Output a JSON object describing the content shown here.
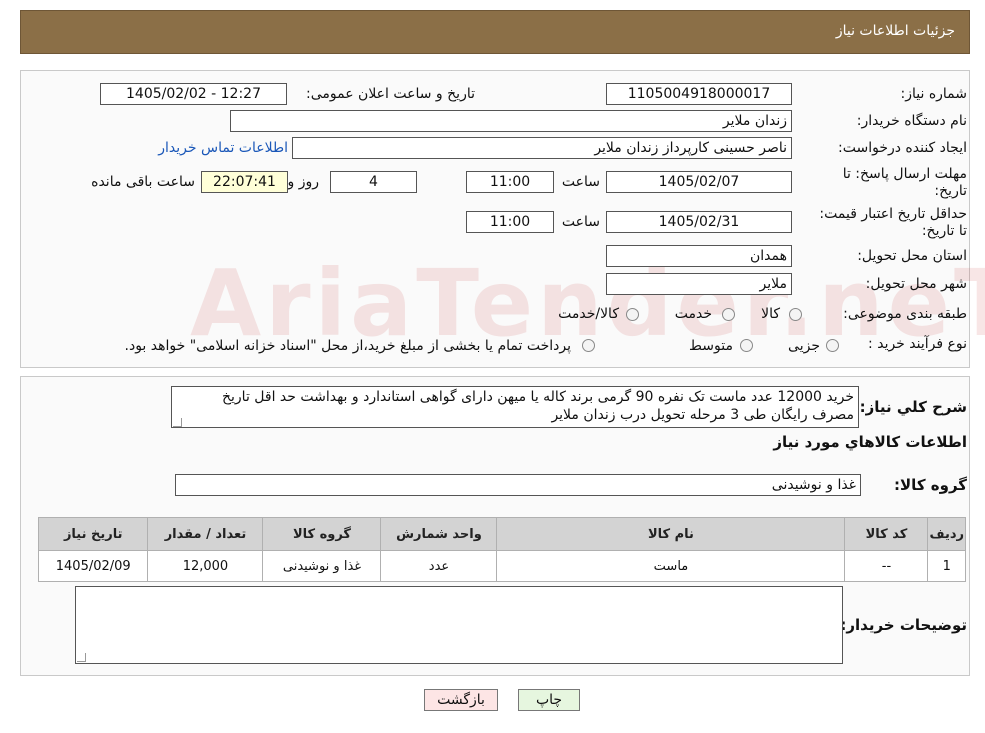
{
  "header": {
    "title": "جزئیات اطلاعات نیاز"
  },
  "watermark": "AriaTender.neT",
  "form": {
    "need_number": {
      "label": "شماره نیاز:",
      "value": "1105004918000017"
    },
    "announce_datetime": {
      "label": "تاریخ و ساعت اعلان عمومی:",
      "value": "1405/02/02 - 12:27"
    },
    "buyer_org": {
      "label": "نام دستگاه خریدار:",
      "value": "زندان ملایر"
    },
    "requester": {
      "label": "ایجاد کننده درخواست:",
      "value": "ناصر  حسینی کارپرداز زندان ملایر",
      "contact_link": "اطلاعات تماس خریدار"
    },
    "reply_deadline": {
      "label": "مهلت ارسال پاسخ: تا تاریخ:",
      "date": "1405/02/07",
      "time_label": "ساعت",
      "time": "11:00",
      "days": "4",
      "days_label": "روز و",
      "remaining": "22:07:41",
      "remaining_label": "ساعت باقی مانده"
    },
    "price_validity": {
      "label": "حداقل تاریخ اعتبار قیمت: تا تاریخ:",
      "date": "1405/02/31",
      "time_label": "ساعت",
      "time": "11:00"
    },
    "province": {
      "label": "استان محل تحویل:",
      "value": "همدان"
    },
    "city": {
      "label": "شهر محل تحویل:",
      "value": "ملایر"
    },
    "category": {
      "label": "طبقه بندی موضوعی:",
      "options": [
        "کالا",
        "خدمت",
        "کالا/خدمت"
      ]
    },
    "purchase_type": {
      "label": "نوع فرآیند خرید :",
      "options": [
        "جزیی",
        "متوسط"
      ],
      "note": "پرداخت تمام یا بخشی از مبلغ خرید،از محل \"اسناد خزانه اسلامی\" خواهد بود."
    }
  },
  "summary": {
    "label": "شرح کلي نياز:",
    "text": "خرید 12000 عدد ماست تک نفره 90 گرمی برند کاله یا میهن دارای گواهی استاندارد و بهداشت حد اقل تاریخ مصرف رایگان طی 3 مرحله تحویل درب زندان ملایر"
  },
  "items_title": "اطلاعات کالاهاي مورد نياز",
  "goods_group": {
    "label": "گروه کالا:",
    "value": "غذا و نوشیدنی"
  },
  "table": {
    "headers": [
      "ردیف",
      "کد کالا",
      "نام کالا",
      "واحد شمارش",
      "گروه کالا",
      "تعداد / مقدار",
      "تاریخ نیاز"
    ],
    "rows": [
      [
        "1",
        "--",
        "ماست",
        "عدد",
        "غذا و نوشیدنی",
        "12,000",
        "1405/02/09"
      ]
    ]
  },
  "buyer_notes": {
    "label": "توضیحات خریدار:",
    "value": ""
  },
  "buttons": {
    "print": "چاپ",
    "back": "بازگشت"
  }
}
